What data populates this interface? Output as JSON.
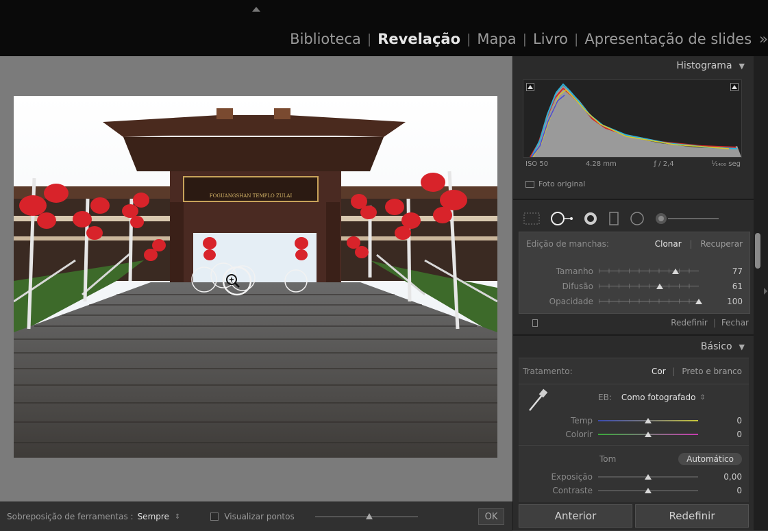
{
  "modules": {
    "items": [
      "Biblioteca",
      "Revelação",
      "Mapa",
      "Livro",
      "Apresentação de slides"
    ],
    "active": "Revelação",
    "more": "»"
  },
  "photo": {
    "sign_text": "FOGUANGSHAN TEMPLO ZULAI"
  },
  "toolbar": {
    "overlay_label": "Sobreposição de ferramentas :",
    "overlay_value": "Sempre",
    "overlay_arrows": "⇕",
    "show_points_label": "Visualizar pontos",
    "ok_label": "OK"
  },
  "histogram": {
    "title": "Histograma",
    "iso": "ISO 50",
    "focal": "4.28 mm",
    "aperture": "ƒ / 2,4",
    "shutter": "¹⁄₁₄₀₀ seg",
    "original_photo": "Foto original"
  },
  "spot_removal": {
    "label": "Edição de manchas:",
    "mode_clone": "Clonar",
    "mode_heal": "Recuperar",
    "sliders": [
      {
        "label": "Tamanho",
        "value": "77",
        "fraction": 0.77
      },
      {
        "label": "Difusão",
        "value": "61",
        "fraction": 0.61
      },
      {
        "label": "Opacidade",
        "value": "100",
        "fraction": 1.0
      }
    ],
    "reset": "Redefinir",
    "close": "Fechar"
  },
  "basic": {
    "title": "Básico",
    "treatment_label": "Tratamento:",
    "treatment_color": "Cor",
    "treatment_bw": "Preto e branco",
    "wb_label": "EB:",
    "wb_value": "Como fotografado",
    "wb_arrows": "⇕",
    "temp_label": "Temp",
    "temp_value": "0",
    "tint_label": "Colorir",
    "tint_value": "0",
    "tone_label": "Tom",
    "auto_label": "Automático",
    "exposure_label": "Exposição",
    "exposure_value": "0,00",
    "contrast_label": "Contraste",
    "contrast_value": "0"
  },
  "footer": {
    "previous": "Anterior",
    "reset": "Redefinir"
  }
}
